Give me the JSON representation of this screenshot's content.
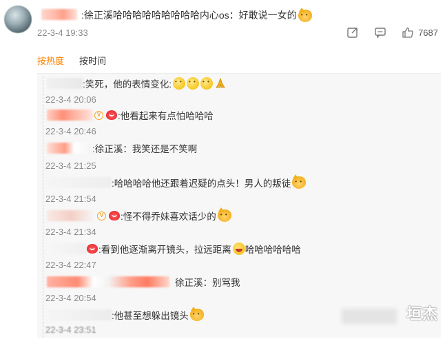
{
  "top_comment": {
    "text": ":徐正溪哈哈哈哈哈哈哈哈哈内心os：好敢说一女的",
    "date": "22-3-4 19:33",
    "likes": "7687"
  },
  "tabs": [
    {
      "label": "按热度",
      "active": true
    },
    {
      "label": "按时间",
      "active": false
    }
  ],
  "replies": [
    {
      "text": ":笑死，他的表情变化:",
      "date": "22-3-4 20:06"
    },
    {
      "text": ":他看起来有点怕哈哈哈",
      "date": "22-3-4 20:46"
    },
    {
      "text": ":徐正溪：我笑还是不笑啊",
      "date": "22-3-4 21:25"
    },
    {
      "text": ":哈哈哈哈他还跟着迟疑的点头！男人的叛徒",
      "date": "22-3-4 21:54"
    },
    {
      "text": ":怪不得乔妹喜欢话少的",
      "date": "22-3-4 21:34"
    },
    {
      "text": ":看到他逐渐离开镜头，拉远距离",
      "text_after": "哈哈哈哈哈哈",
      "date": "22-3-4 22:47"
    },
    {
      "text": "徐正溪：别骂我",
      "date": "22-3-4 20:54"
    },
    {
      "text": ":他甚至想躲出镜头",
      "date": "22-3-4 23:51"
    }
  ],
  "watermark": "垣杰",
  "icons": {
    "share": "share-icon",
    "comment": "comment-icon",
    "like": "thumbs-up-icon",
    "vip": "vip-badge-icon"
  },
  "colors": {
    "accent": "#ff8200",
    "date": "#8a8a8a",
    "reply_bg": "#f7f7f7"
  }
}
